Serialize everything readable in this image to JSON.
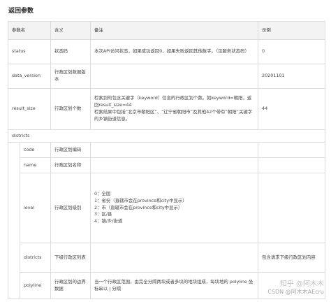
{
  "title": "返回参数",
  "table": {
    "headers": {
      "param": "参数名",
      "meaning": "含义",
      "note": "备注",
      "example": "示例"
    },
    "status": {
      "name": "status",
      "meaning": "状态码",
      "note": "本次API访问状态，如果成功返回0，如果失败返回其他数字。（见服务状态码）",
      "example": "0"
    },
    "data_version": {
      "name": "data_version",
      "meaning": "行政区划数据版本",
      "note": "",
      "example": "20201101"
    },
    "result_size": {
      "name": "result_size",
      "meaning": "行政区划个数",
      "note_lines": [
        "检索到的包含关键字（keyword）信息的行政区划个数。如keyword=朝阳，返回result_size=44",
        "检索结果中包括“北京市朝阳区”、“辽宁省朝阳市”及其他42个带有“朝阳”关键字的乡镇街道信息。"
      ],
      "example": "44"
    },
    "districts": {
      "name": "districts"
    },
    "code": {
      "name": "code",
      "meaning": "行政区划编码"
    },
    "name": {
      "name": "name",
      "meaning": "行政区划名称"
    },
    "level": {
      "name": "level",
      "meaning": "行政区划级别",
      "note_lines": [
        "0：全国",
        "1：省份（直辖市会在province和city中显示）",
        "2：市（直辖市会在province和city中显示）",
        "3：区/县",
        "4：镇/乡/街道"
      ]
    },
    "sub_districts": {
      "name": "districts",
      "meaning": "下级行政区列表",
      "note": "",
      "example": "包含请求下级行政区划内容"
    },
    "polyline": {
      "name": "polyline",
      "meaning": "行政区划的边界数据",
      "note": "当一个行政区范围，由完全分隔两块或者多块的地块组成，每块地的 polyline 坐标串以 | 分隔",
      "example": ""
    }
  },
  "watermark": {
    "line1": "知乎 @阿木木",
    "line2": "CSDN @阿木木AEcru"
  }
}
